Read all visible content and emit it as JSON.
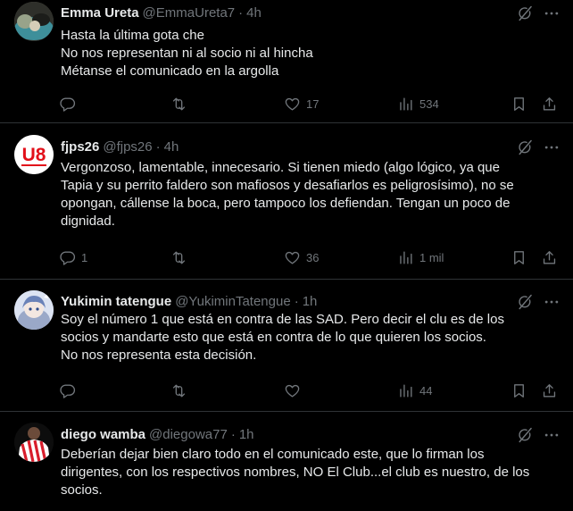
{
  "tweets": [
    {
      "name": "Emma Ureta",
      "handle": "@EmmaUreta7",
      "time": "4h",
      "lines": [
        "Hasta la última gota che",
        "No nos representan ni al socio ni al hincha",
        "Métanse el comunicado en la argolla"
      ],
      "replies": "",
      "likes": "17",
      "views": "534"
    },
    {
      "name": "fjps26",
      "handle": "@fjps26",
      "time": "4h",
      "lines": [
        "Vergonzoso, lamentable, innecesario. Si tienen miedo (algo lógico, ya que",
        "Tapia y su perrito faldero son mafiosos y desafiarlos es peligrosísimo), no se",
        "opongan, cállense la boca, pero tampoco los defiendan. Tengan un poco de",
        "dignidad."
      ],
      "replies": "1",
      "likes": "36",
      "views": "1 mil"
    },
    {
      "name": "Yukimin tatengue",
      "handle": "@YukiminTatengue",
      "time": "1h",
      "lines": [
        "Soy el número 1 que está en contra de las SAD. Pero decir el clu es de los",
        "socios y mandarte esto que está en contra de lo que quieren los socios.",
        "No nos representa esta decisión."
      ],
      "replies": "",
      "likes": "",
      "views": "44"
    },
    {
      "name": "diego wamba",
      "handle": "@diegowa77",
      "time": "1h",
      "lines": [
        "Deberían dejar bien claro todo en el comunicado este, que lo firman los",
        "dirigentes, con los respectivos nombres, NO El Club...el club es nuestro, de los",
        "socios."
      ],
      "replies": "",
      "likes": "",
      "views": ""
    }
  ],
  "avatar2_text": "U8",
  "colors": {
    "background": "#000000",
    "text": "#e7e9ea",
    "muted": "#71767b",
    "divider": "#2f3336",
    "accent_red": "#e2101a"
  },
  "icons": [
    "grok-icon",
    "more-icon",
    "reply-icon",
    "retweet-icon",
    "like-icon",
    "views-icon",
    "bookmark-icon",
    "share-icon"
  ]
}
